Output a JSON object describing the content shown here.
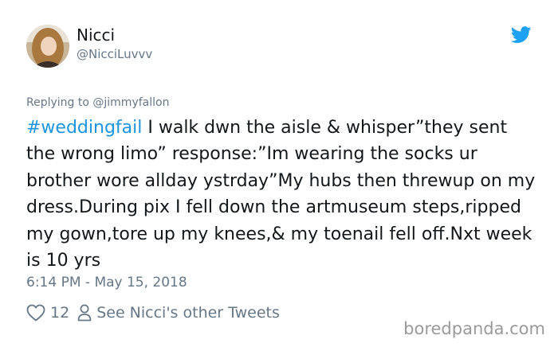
{
  "tweet": {
    "display_name": "Nicci",
    "handle": "@NicciLuvvv",
    "reply_prefix": "Replying to ",
    "reply_to": "@jimmyfallon",
    "hashtag": "#weddingfail",
    "text": " I walk dwn the aisle & whisper”they sent the wrong limo” response:”Im wearing the socks ur brother wore allday ystrday”My hubs then threwup on my dress.During pix I fell down the artmuseum steps,ripped my gown,tore up my knees,& my toenail fell off.Nxt week is 10 yrs",
    "timestamp": "6:14 PM - May 15, 2018",
    "likes": "12",
    "other_tweets_label": "See Nicci's other Tweets"
  },
  "watermark": "boredpanda.com",
  "colors": {
    "text": "#14171a",
    "secondary": "#657786",
    "link": "#1b95e0",
    "twitter_blue": "#1da1f2",
    "watermark": "#9a9a9a"
  },
  "icons": [
    "twitter-bird-icon",
    "heart-icon",
    "person-icon"
  ]
}
